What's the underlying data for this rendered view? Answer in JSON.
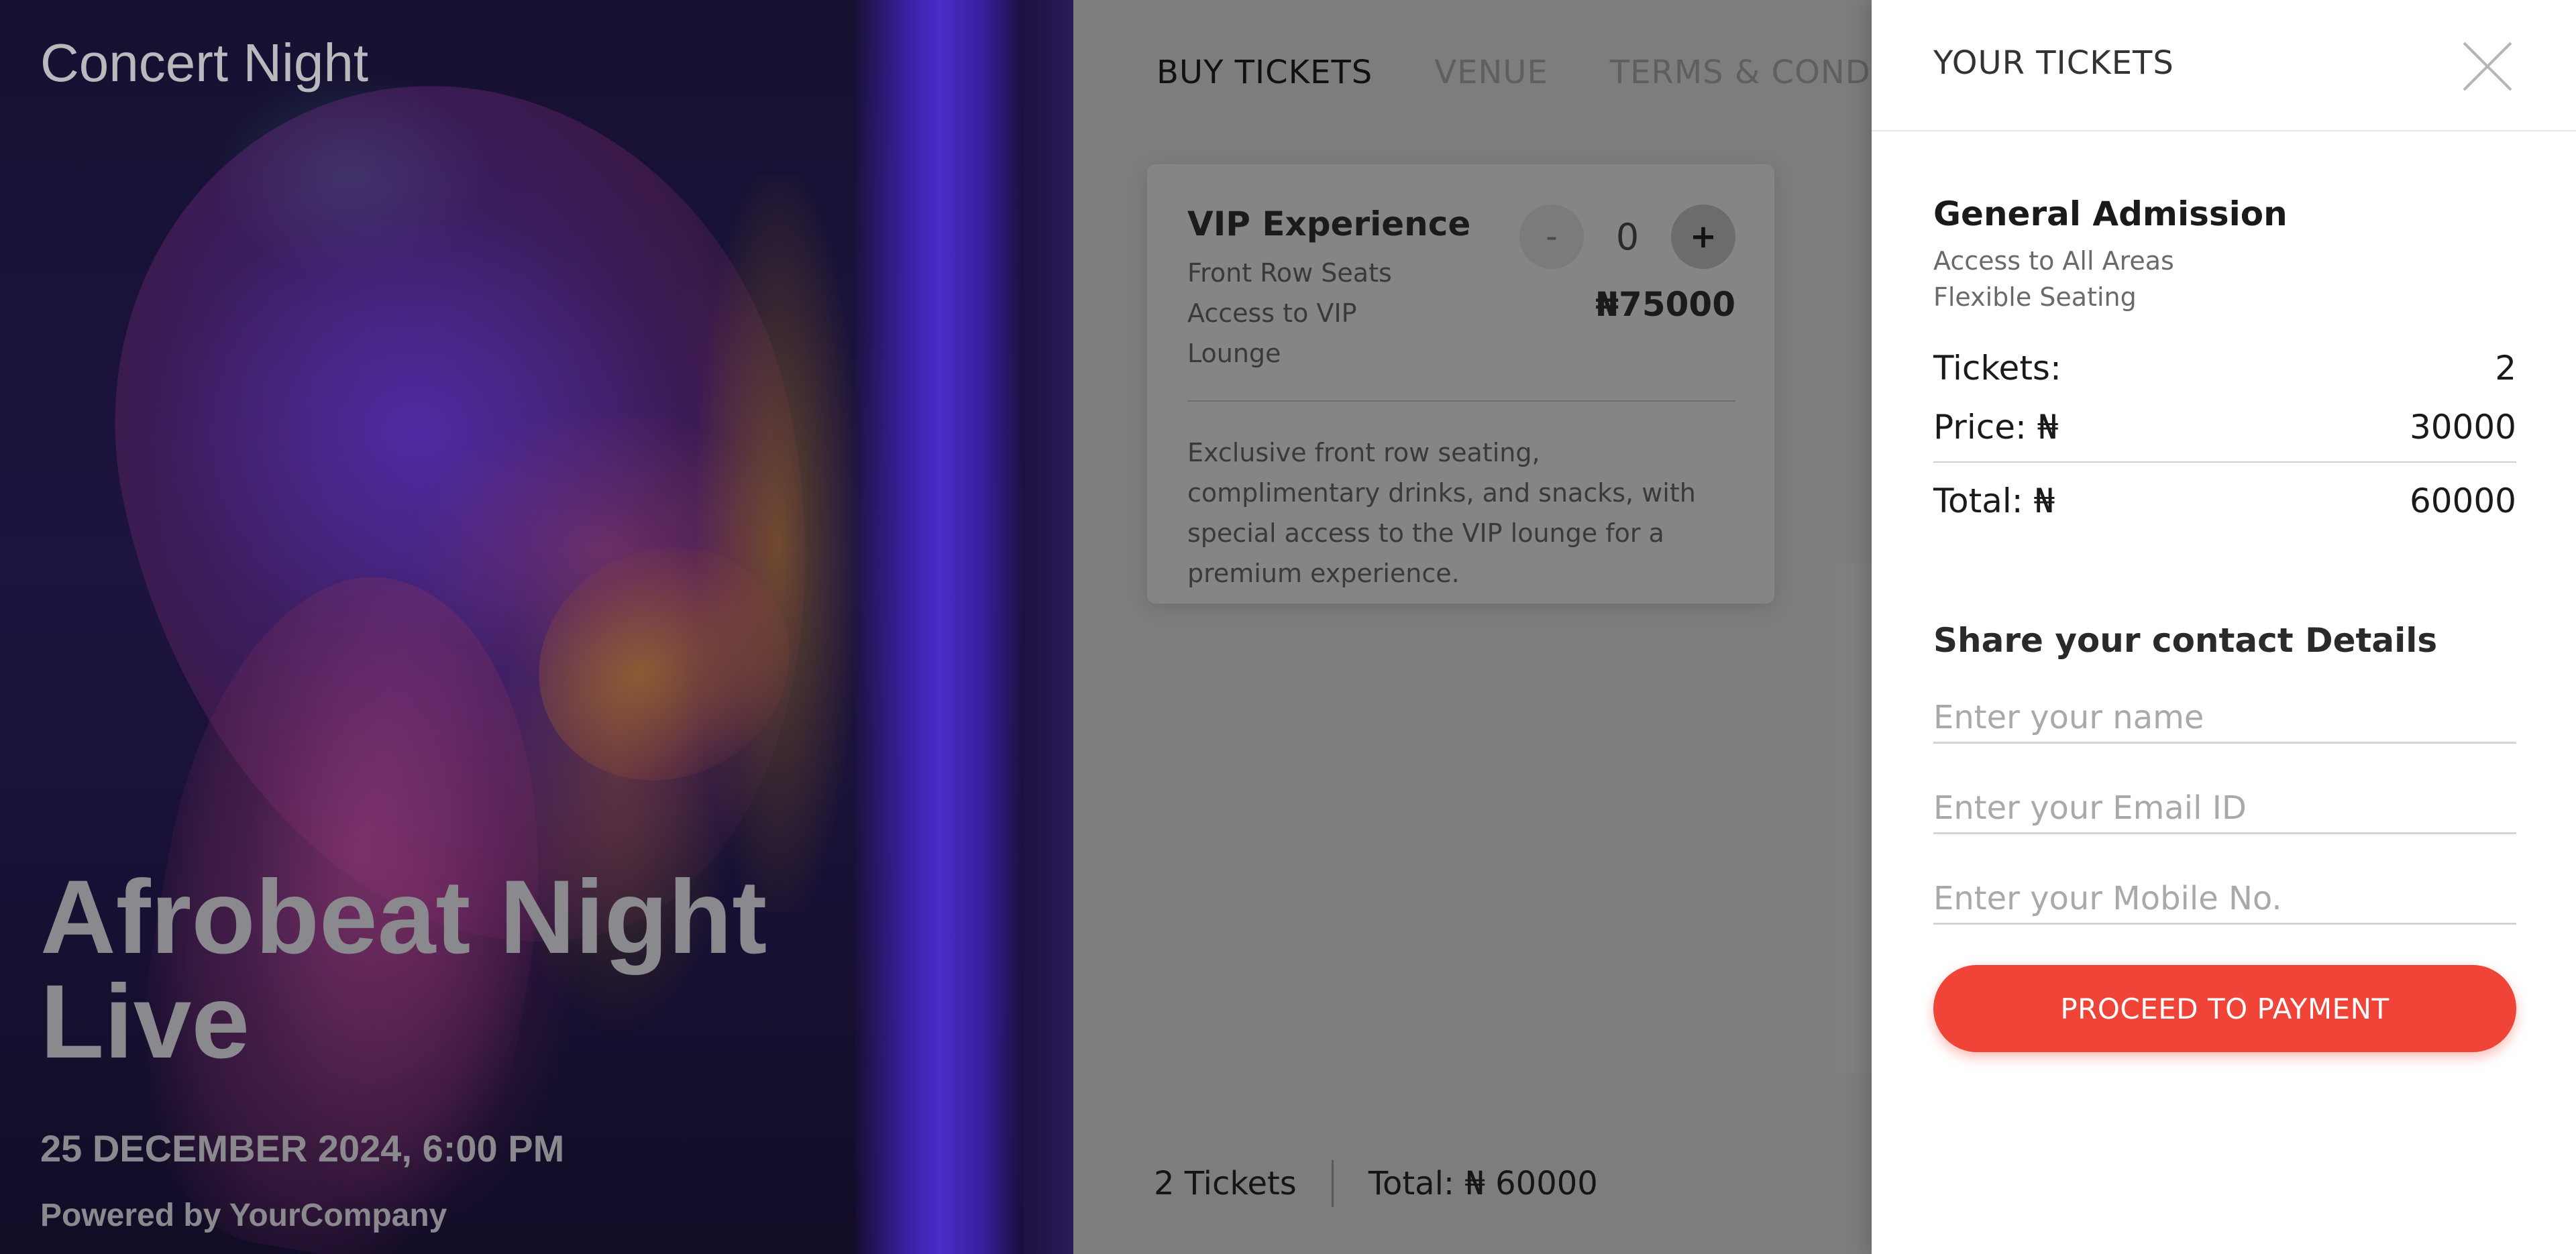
{
  "hero": {
    "app_title": "Concert Night",
    "event_title": "Afrobeat Night\nLive",
    "date_time": "25 DECEMBER 2024, 6:00 PM",
    "powered_by": "Powered by YourCompany"
  },
  "tabs": [
    {
      "label": "BUY TICKETS",
      "active": true
    },
    {
      "label": "VENUE",
      "active": false
    },
    {
      "label": "TERMS & CONDITIO",
      "active": false
    }
  ],
  "ticket_card": {
    "name": "VIP Experience",
    "features": [
      "Front Row Seats",
      "Access to VIP",
      "Lounge"
    ],
    "quantity": "0",
    "minus_label": "-",
    "plus_label": "+",
    "price": "₦75000",
    "description": "Exclusive front row seating, complimentary drinks, and snacks, with special access to the VIP lounge for a premium experience."
  },
  "footer": {
    "ticket_count": "2 Tickets",
    "total": "Total: ₦ 60000"
  },
  "drawer": {
    "title": "YOUR TICKETS",
    "close_icon": "close-icon",
    "ticket_type": "General Admission",
    "features": [
      "Access to All Areas",
      "Flexible Seating"
    ],
    "tickets_label": "Tickets:",
    "tickets_value": "2",
    "price_label": "Price: ₦",
    "price_value": "30000",
    "total_label": "Total: ₦",
    "total_value": "60000",
    "contact_title": "Share your contact Details",
    "name_placeholder": "Enter your name",
    "email_placeholder": "Enter your Email ID",
    "mobile_placeholder": "Enter your Mobile No.",
    "pay_button": "PROCEED TO PAYMENT"
  },
  "colors": {
    "accent": "#f04438",
    "overlay": "#7d7d7d",
    "drawer_bg": "#ffffff"
  }
}
